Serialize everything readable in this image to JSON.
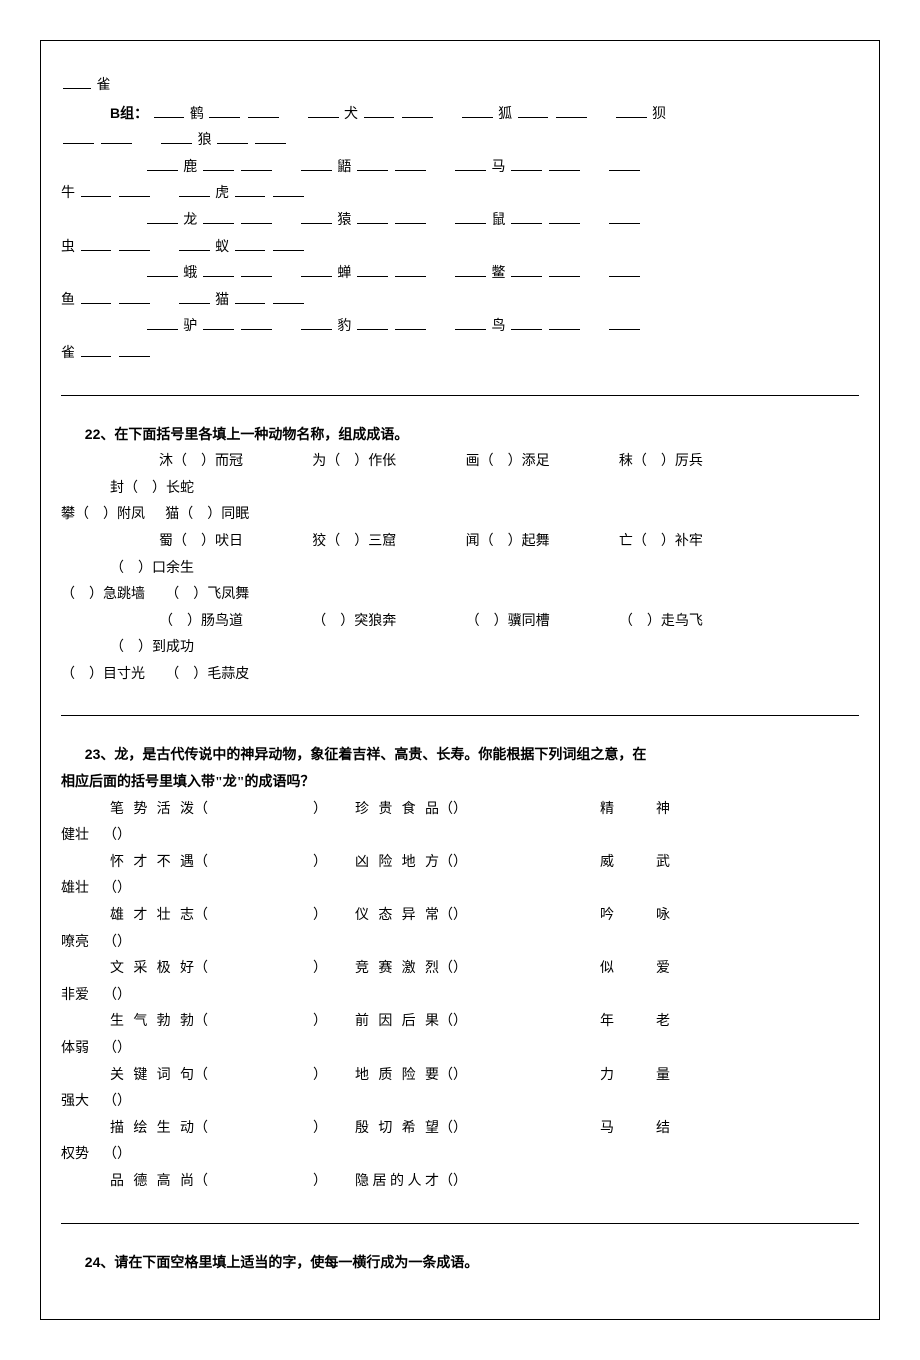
{
  "top_fragment": "雀",
  "group_b_label": "B组：",
  "group_b_rows": [
    [
      "鹤",
      "犬",
      "狐",
      "狈"
    ],
    [
      "",
      "狼"
    ],
    [
      "鹿",
      "鼯",
      "马",
      "牛"
    ],
    [
      "",
      "虎"
    ],
    [
      "龙",
      "猿",
      "鼠",
      "虫"
    ],
    [
      "",
      "蚁"
    ],
    [
      "蛾",
      "蝉",
      "鳖",
      "鱼"
    ],
    [
      "",
      "猫"
    ],
    [
      "驴",
      "豹",
      "鸟",
      "雀"
    ]
  ],
  "q22": {
    "num": "22",
    "heading": "、在下面括号里各填上一种动物名称，组成成语。",
    "items_line1": [
      "沐（　）而冠",
      "为（　）作伥",
      "画（　）添足",
      "秣（　）厉兵",
      "封（　）长蛇"
    ],
    "items_line1_cont": [
      "攀（　）附凤",
      "猫（　）同眠"
    ],
    "items_line2": [
      "蜀（　）吠日",
      "狡（　）三窟",
      "闻（　）起舞",
      "亡（　）补牢",
      "（　）口余生"
    ],
    "items_line2_cont": [
      "（　）急跳墙",
      "（　）飞凤舞"
    ],
    "items_line3": [
      "（　）肠鸟道",
      "（　）突狼奔",
      "（　）骥同槽",
      "（　）走乌飞",
      "（　）到成功"
    ],
    "items_line3_cont": [
      "（　）目寸光",
      "（　）毛蒜皮"
    ]
  },
  "q23": {
    "num": "23",
    "heading_line1": "、龙，是古代传说中的神异动物，象征着吉祥、高贵、长寿。你能根据下列词组之意，在",
    "heading_line2": "相应后面的括号里填入带\"龙\"的成语吗？",
    "rows": [
      {
        "l1": "笔势活泼",
        "l2": "珍贵食品",
        "l3": "精神",
        "cont": "健壮"
      },
      {
        "l1": "怀才不遇",
        "l2": "凶险地方",
        "l3": "威武",
        "cont": "雄壮"
      },
      {
        "l1": "雄才壮志",
        "l2": "仪态异常",
        "l3": "吟咏",
        "cont": "嘹亮"
      },
      {
        "l1": "文采极好",
        "l2": "竞赛激烈",
        "l3": "似爱",
        "cont": "非爱"
      },
      {
        "l1": "生气勃勃",
        "l2": "前因后果",
        "l3": "年老",
        "cont": "体弱"
      },
      {
        "l1": "关键词句",
        "l2": "地质险要",
        "l3": "力量",
        "cont": "强大"
      },
      {
        "l1": "描绘生动",
        "l2": "殷切希望",
        "l3": "马结",
        "cont": "权势"
      },
      {
        "l1": "品德高尚",
        "l2": "隐居的人才",
        "l3": "",
        "cont": ""
      }
    ]
  },
  "q24": {
    "num": "24",
    "heading": "、请在下面空格里填上适当的字，使每一横行成为一条成语。"
  }
}
